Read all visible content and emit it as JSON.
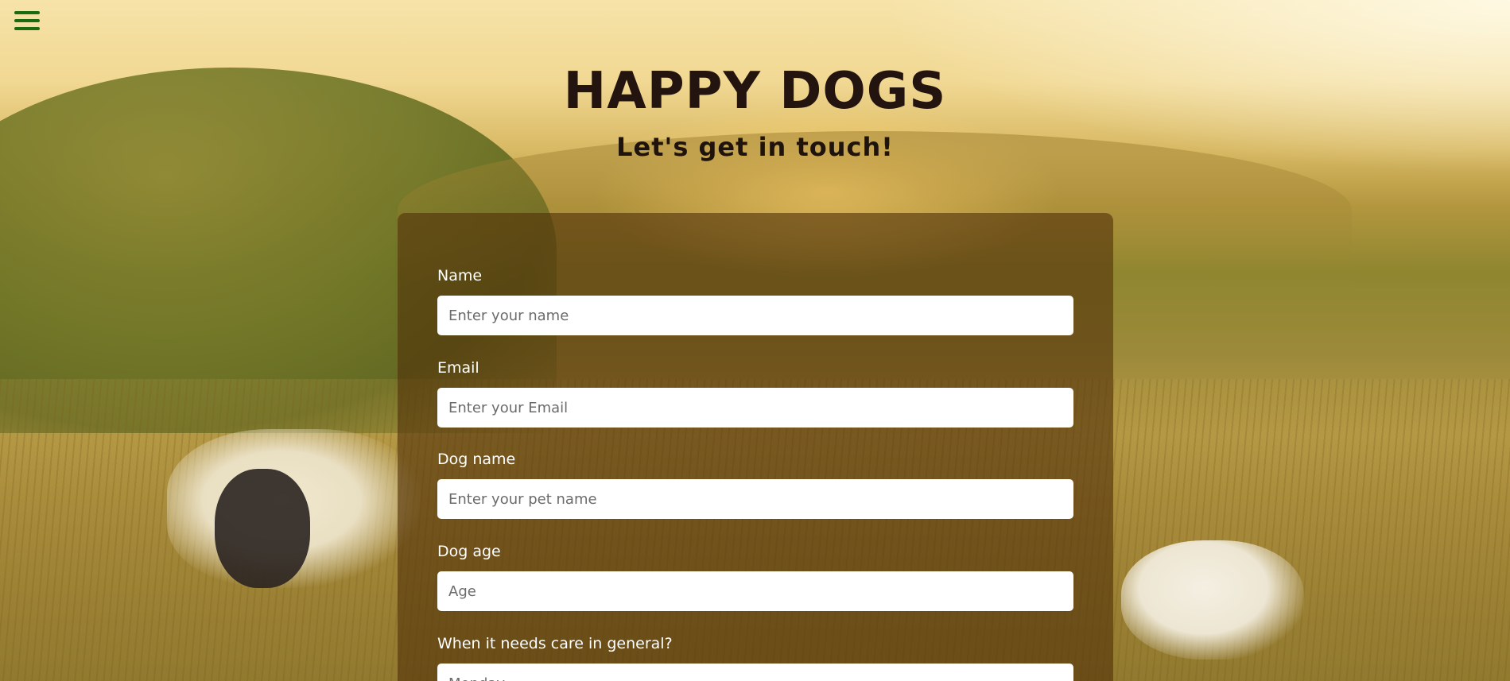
{
  "nav": {
    "menu_icon": "hamburger-menu-icon",
    "menu_color": "#1a6b10"
  },
  "header": {
    "title": "HAPPY DOGS",
    "subtitle": "Let's get in touch!"
  },
  "form": {
    "fields": [
      {
        "label": "Name",
        "placeholder": "Enter your name",
        "value": ""
      },
      {
        "label": "Email",
        "placeholder": "Enter your Email",
        "value": ""
      },
      {
        "label": "Dog name",
        "placeholder": "Enter your pet name",
        "value": ""
      },
      {
        "label": "Dog age",
        "placeholder": "Age",
        "value": ""
      },
      {
        "label": "When it needs care in general?",
        "placeholder": "Monday",
        "value": ""
      }
    ]
  },
  "colors": {
    "title": "#23140f",
    "panel": "#52320a",
    "label": "#ffffff"
  }
}
